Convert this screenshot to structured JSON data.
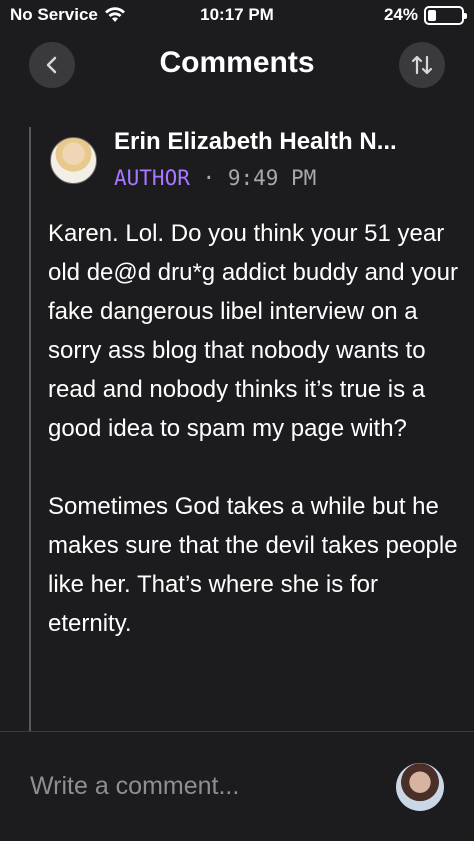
{
  "status_bar": {
    "carrier": "No Service",
    "time": "10:17 PM",
    "battery": "24%",
    "battery_level": 0.24
  },
  "header": {
    "title": "Comments",
    "back_icon": "chevron-left-icon",
    "sort_icon": "sort-arrows-icon"
  },
  "comment": {
    "author": "Erin Elizabeth Health N...",
    "badge": "AUTHOR",
    "separator": "·",
    "time": "9:49 PM",
    "body": "Karen.  Lol. Do you think your 51 year old de@d dru*g addict buddy and your fake dangerous libel interview on a sorry ass blog that nobody wants to read and nobody thinks it’s true is a good idea to spam my page with?\n\nSometimes God takes a while but he makes sure that the devil takes people like her. That’s where she is for eternity."
  },
  "composer": {
    "placeholder": "Write a comment..."
  }
}
